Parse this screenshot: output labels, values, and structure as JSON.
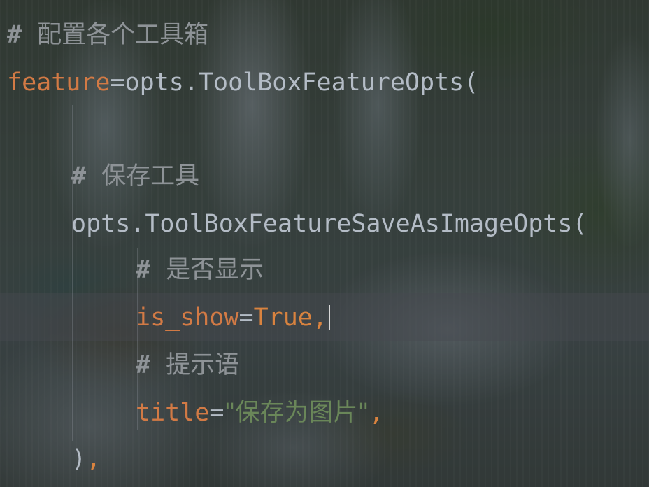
{
  "code": {
    "l1_hash": "#",
    "l1_comment": "配置各个工具箱",
    "l2_kw": "feature",
    "l2_rest": "=opts.ToolBoxFeatureOpts(",
    "l3_hash": "#",
    "l3_comment": "保存工具",
    "l4_text": "opts.ToolBoxFeatureSaveAsImageOpts(",
    "l5_hash": "#",
    "l5_comment": "是否显示",
    "l6_kw": "is_show",
    "l6_eq": "=",
    "l6_val": "True,",
    "l7_hash": "#",
    "l7_comment": "提示语",
    "l8_kw": "title",
    "l8_eq": "=",
    "l8_str": "\"保存为图片\"",
    "l8_comma": ",",
    "l9_paren": ")",
    "l9_comma": ","
  },
  "colors": {
    "keyword": "#d27a45",
    "identifier": "#b4bcc6",
    "comment": "#8e9397",
    "string": "#6a8759",
    "boolean": "#d9833f"
  }
}
